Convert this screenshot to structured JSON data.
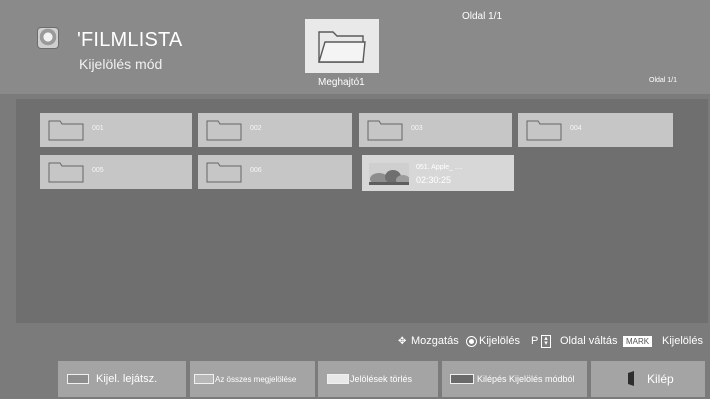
{
  "header": {
    "title": "'FILMLISTA",
    "subtitle": "Kijelölés mód",
    "drive_label": "Meghajtó1",
    "page_top": "Oldal 1/1",
    "page_right": "Oldal 1/1"
  },
  "items": [
    {
      "type": "folder",
      "label": "001"
    },
    {
      "type": "folder",
      "label": "002"
    },
    {
      "type": "folder",
      "label": "003"
    },
    {
      "type": "folder",
      "label": "004"
    },
    {
      "type": "folder",
      "label": "005"
    },
    {
      "type": "folder",
      "label": "006"
    },
    {
      "type": "video",
      "name": "051. Apple_ ....",
      "duration": "02:30:25"
    }
  ],
  "help": {
    "move": "Mozgatás",
    "select": "Kijelölés",
    "p_key": "P",
    "page_change": "Oldal váltás",
    "mark_key": "MARK",
    "mark_label": "Kijelölés"
  },
  "buttons": [
    {
      "label": "Kijel. lejátsz.",
      "color": "#8e8e8e"
    },
    {
      "label": "Az összes megjelölése",
      "color": "#b8b8b8"
    },
    {
      "label": "Jelölések törlés",
      "color": "#e8e8e8"
    },
    {
      "label": "Kilépés Kijelölés módból",
      "color": "#6a6a6a"
    },
    {
      "label": "Kilép",
      "icon": "exit-icon"
    }
  ],
  "colors": {
    "background": "#7b7b7b",
    "tile": "#c6c6c6",
    "button": "#a4a4a4"
  }
}
